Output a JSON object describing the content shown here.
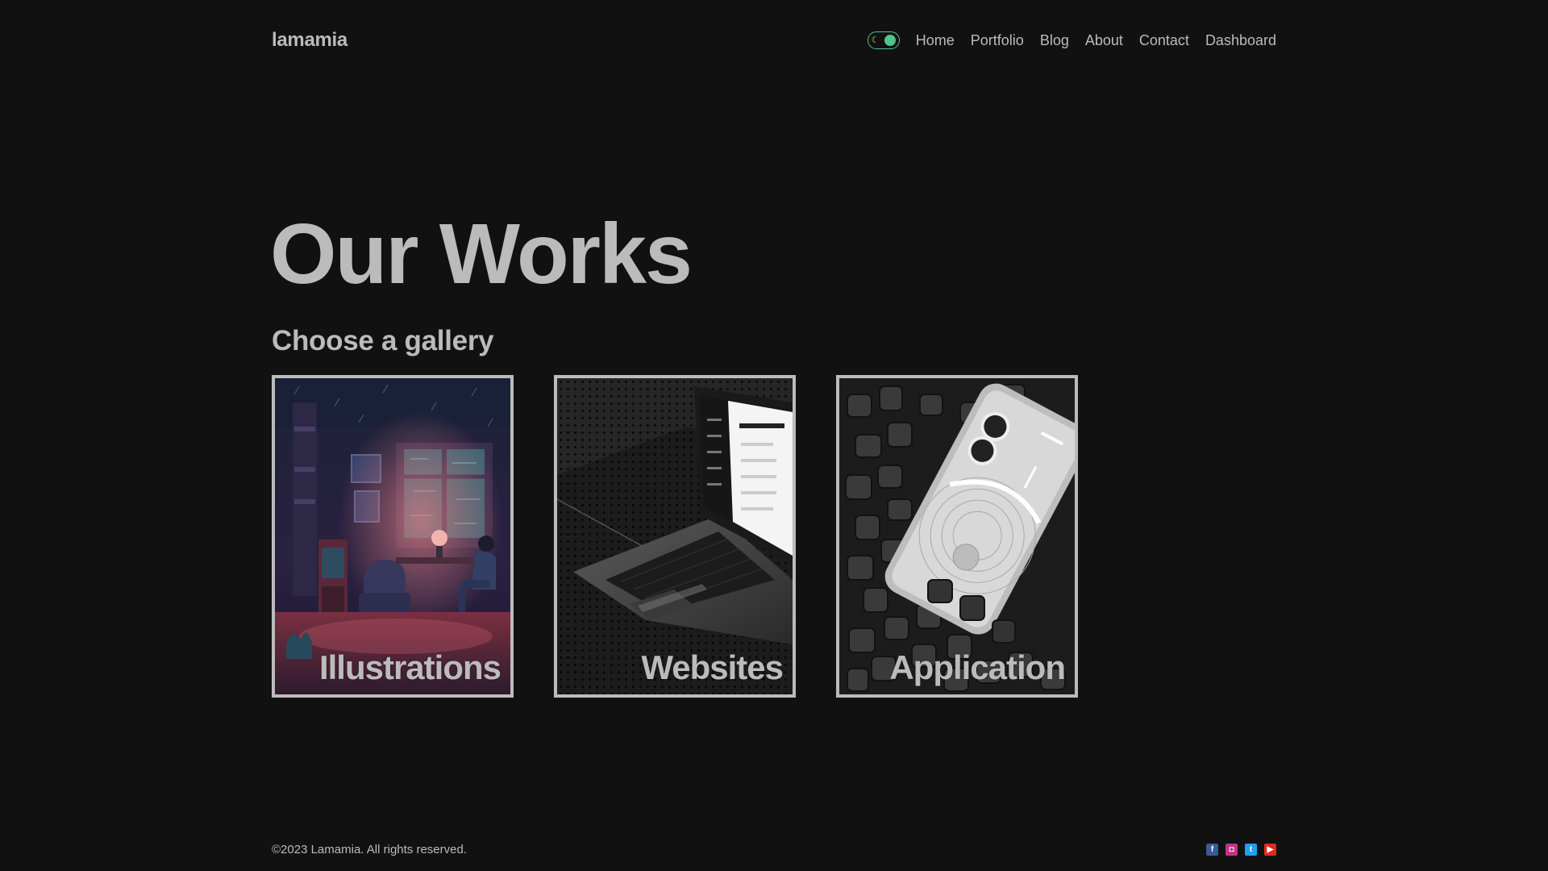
{
  "header": {
    "logo": "lamamia",
    "nav": [
      "Home",
      "Portfolio",
      "Blog",
      "About",
      "Contact",
      "Dashboard"
    ]
  },
  "hero": {
    "title": "Our Works",
    "subtitle": "Choose a gallery"
  },
  "gallery": [
    {
      "label": "Illustrations"
    },
    {
      "label": "Websites"
    },
    {
      "label": "Application"
    }
  ],
  "footer": {
    "copyright": "©2023 Lamamia. All rights reserved.",
    "socials": [
      {
        "icon": "facebook-icon",
        "color": "#3b5998"
      },
      {
        "icon": "instagram-icon",
        "color": "#c13584"
      },
      {
        "icon": "twitter-icon",
        "color": "#1da1f2"
      },
      {
        "icon": "youtube-icon",
        "color": "#e02a20"
      }
    ]
  },
  "theme": {
    "background": "#111111",
    "text": "#bbbbbb",
    "toggle_accent": "#53c28b"
  }
}
